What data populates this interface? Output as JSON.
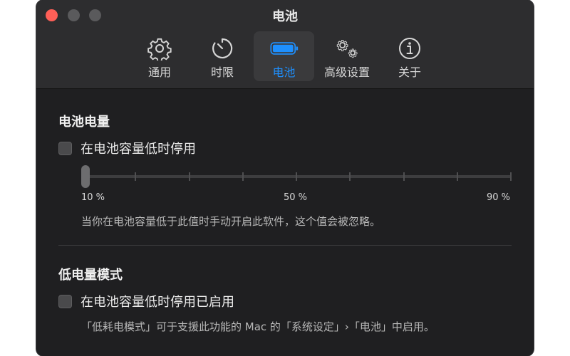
{
  "window": {
    "title": "电池"
  },
  "tabs": [
    {
      "label": "通用",
      "icon": "gear-icon"
    },
    {
      "label": "时限",
      "icon": "timer-icon"
    },
    {
      "label": "电池",
      "icon": "battery-icon",
      "active": true
    },
    {
      "label": "高级设置",
      "icon": "gears-icon"
    },
    {
      "label": "关于",
      "icon": "info-icon"
    }
  ],
  "battery_level": {
    "title": "电池电量",
    "checkbox_label": "在电池容量低时停用",
    "checked": false,
    "slider": {
      "value_percent": 10,
      "min_label": "10 %",
      "mid_label": "50 %",
      "max_label": "90 %"
    },
    "help": "当你在电池容量低于此值时手动开启此软件，这个值会被忽略。"
  },
  "low_power": {
    "title": "低电量模式",
    "checkbox_label": "在电池容量低时停用已启用",
    "checked": false,
    "help": "「低耗电模式」可于支援此功能的 Mac 的「系统设定」›「电池」中启用。"
  },
  "colors": {
    "accent": "#1e90ff",
    "close": "#ff5f57",
    "background": "#1f1f21",
    "titlebar": "#2d2d2f"
  }
}
